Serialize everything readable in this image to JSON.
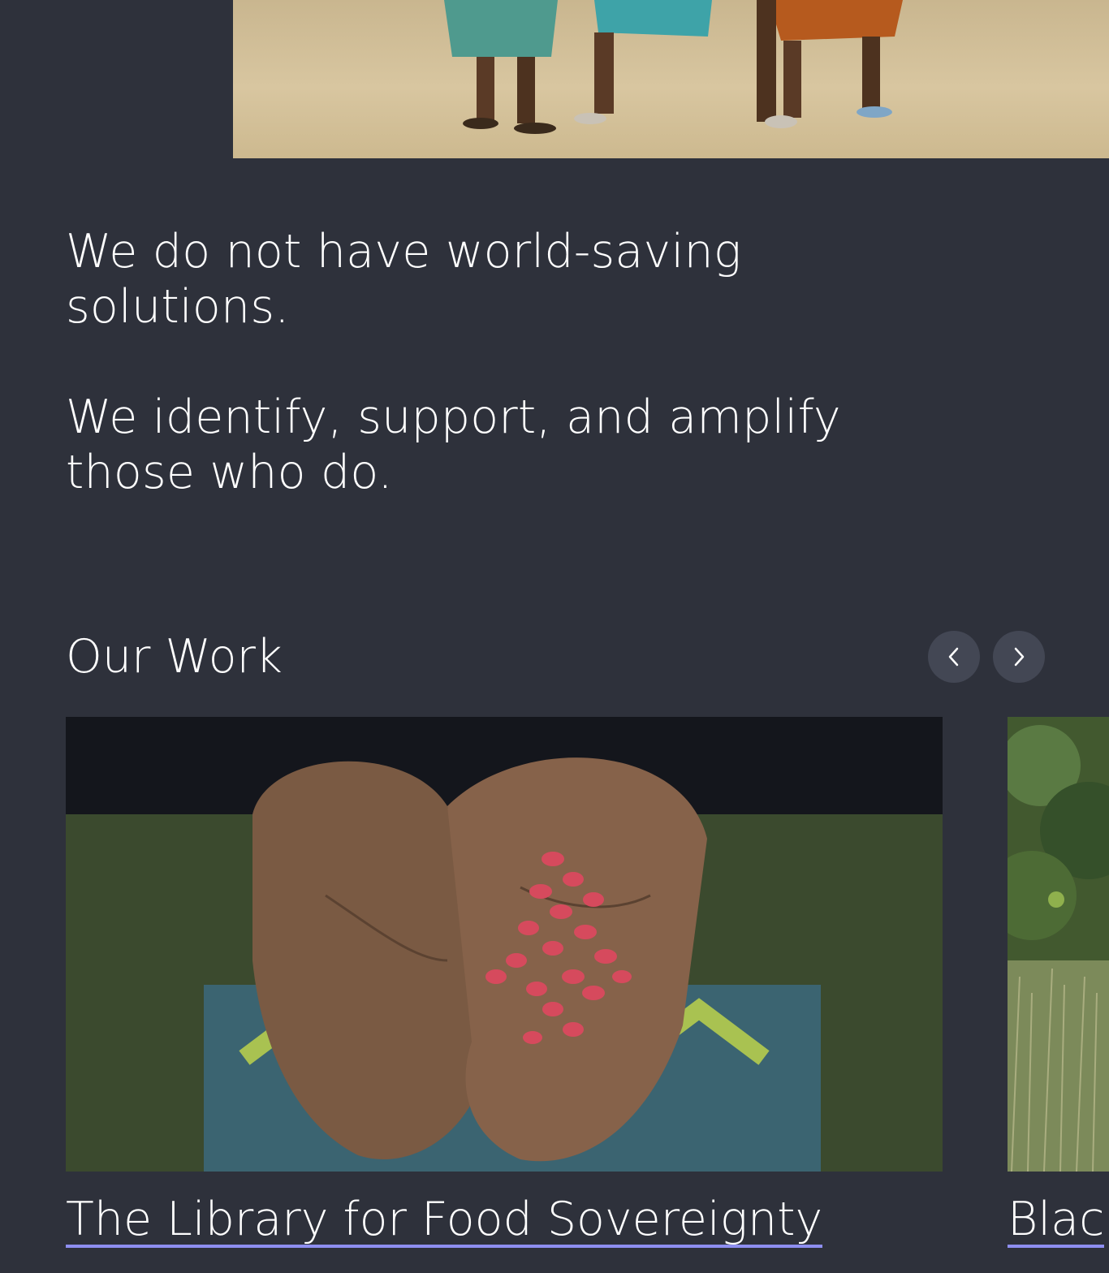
{
  "hero": {
    "image_description_icon": "photo-icon"
  },
  "intro": {
    "line1": "We do not have world-saving solutions.",
    "line2": "We identify, support, and amplify those who do."
  },
  "our_work": {
    "title": "Our Work",
    "prev_icon": "chevron-left-icon",
    "next_icon": "chevron-right-icon",
    "cards": [
      {
        "title": "The Library for Food Sovereignty"
      },
      {
        "title": "Blac"
      }
    ]
  },
  "colors": {
    "background": "#2e313b",
    "nav_button": "#434754",
    "link_underline": "#8e8ef0",
    "text": "#ffffff"
  }
}
